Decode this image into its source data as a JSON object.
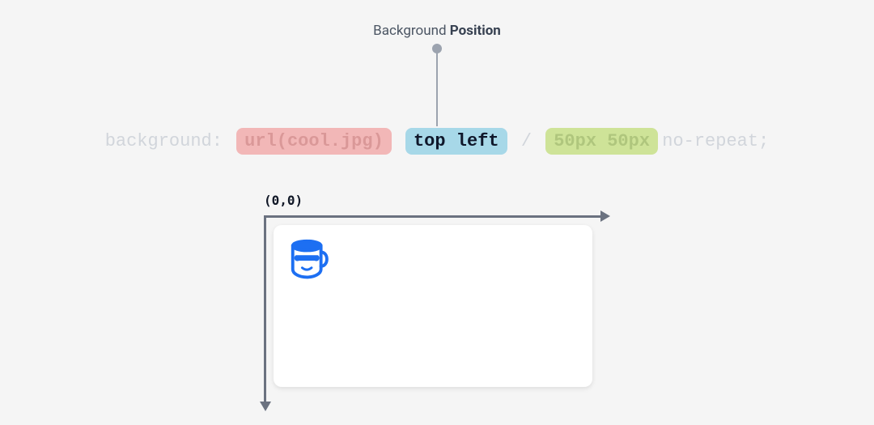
{
  "title": {
    "prefix": "Background ",
    "emphasis": "Position"
  },
  "code": {
    "property": "background:",
    "url": "url(cool.jpg)",
    "position": "top left",
    "separator": "/",
    "size": "50px 50px",
    "repeat": "no-repeat;"
  },
  "origin_label": "(0,0)",
  "colors": {
    "highlight_bg": "#a7d8e8",
    "url_bg": "rgba(239,68,68,0.35)",
    "size_bg": "rgba(190,219,112,0.7)",
    "axis": "#6b7280",
    "icon": "#1d6ff2"
  }
}
